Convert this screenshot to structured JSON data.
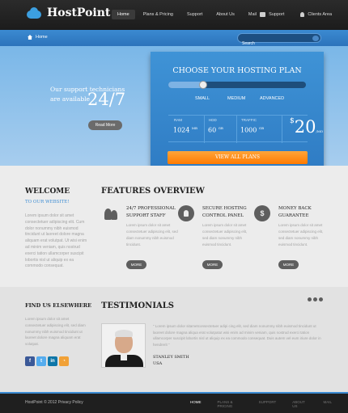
{
  "header": {
    "logo_text": "HostPoint",
    "nav": [
      "Home",
      "Plans & Pricing",
      "Support",
      "About Us",
      "Mail"
    ],
    "support_label": "Support",
    "clients_label": "Clients Area"
  },
  "breadcrumb": {
    "home_label": "Home"
  },
  "search": {
    "placeholder": "Search"
  },
  "hero": {
    "support_line1": "Our support technicians",
    "support_line2": "are available",
    "support_big": "24/7",
    "read_more": "Read More"
  },
  "plan": {
    "title": "CHOOSE YOUR HOSTING PLAN",
    "options": [
      "SMALL",
      "MEDIUM",
      "ADVANCED"
    ],
    "slider_level": 0.25,
    "ram_label": "RAM",
    "ram_value": "1024",
    "ram_unit": "MB",
    "hdd_label": "HDD",
    "hdd_value": "60",
    "hdd_unit": "GB",
    "traffic_label": "TRAFFIC",
    "traffic_value": "1000",
    "traffic_unit": "GB",
    "currency": "$",
    "price": "20",
    "per": "/MO",
    "button": "VIEW ALL PLANS"
  },
  "welcome": {
    "title": "WELCOME",
    "subtitle": "TO OUR WEBSITE!",
    "body": "Lorem ipsum dolor sit amet consectetuer adipiscing elit. Cum dolor nonummy nibh euismod tincidunt ut laoreet dolore magna aliquam erat volutpat. Ut wisi enim ad minim veniam, quis nostrud exerci tation ullamcorper suscipit lobortis nisl ut aliquip ex ea commodo consequat."
  },
  "features": {
    "title": "FEATURES OVERVIEW",
    "items": [
      {
        "icon": "users-icon",
        "head1": "24/7 PROFESSIONAL",
        "head2": "SUPPORT STAFF",
        "body": "Lorem ipsum dolor sit amet consectetuer adipiscing elit, sed diam nonummy nibh euismod tincidunt.",
        "more": "MORE"
      },
      {
        "icon": "lock-icon",
        "head1": "SECURE HOSTING",
        "head2": "CONTROL PANEL",
        "body": "Lorem ipsum dolor sit amet consectetuer adipiscing elit, sed diam nonummy nibh euismod tincidunt.",
        "more": "MORE"
      },
      {
        "icon": "money-icon",
        "head1": "MONEY BACK",
        "head2": "GUARANTEE",
        "body": "Lorem ipsum dolor sit amet consectetuer adipiscing elit, sed diam nonummy nibh euismod tincidunt.",
        "more": "MORE"
      }
    ]
  },
  "find": {
    "title": "FIND US ELSEWHERE",
    "body": "Lorem ipsum dolor sit amet consectetuer adipiscing elit, sed diam nonummy nibh euismod tincidunt ut laoreet dolore magna aliquam erat volutpat."
  },
  "socials": [
    {
      "label": "f",
      "color": "#3b5998",
      "icon": "facebook-icon"
    },
    {
      "label": "t",
      "color": "#55acee",
      "icon": "twitter-icon"
    },
    {
      "label": "in",
      "color": "#0e76a8",
      "icon": "linkedin-icon"
    },
    {
      "label": "◔",
      "color": "#f1a137",
      "icon": "rss-icon"
    }
  ],
  "testimonials": {
    "title": "TESTIMONIALS",
    "quote": "“ Lorem ipsum dolor sitametconsectetuer adipi cing elit, sed diam nonummy nibh euismod tincidunt ut laoreet dolore magna aliqua erat volutpatut wisi enim ad minim veniam, quis nostrud exerci tation ullamcorper suscipit lobortis nisl ut aliquip ex ea commodo consequat. Duis autem vel eum iriure dolor in hendrerit ”",
    "author": "STANLEY SMITH",
    "location": "USA"
  },
  "footer": {
    "copyright": "HostPoint © 2012 Privacy Policy",
    "nav": [
      "HOME",
      "PLANS & PRICING",
      "SUPPORT",
      "ABOUT US",
      "MAIL"
    ]
  }
}
